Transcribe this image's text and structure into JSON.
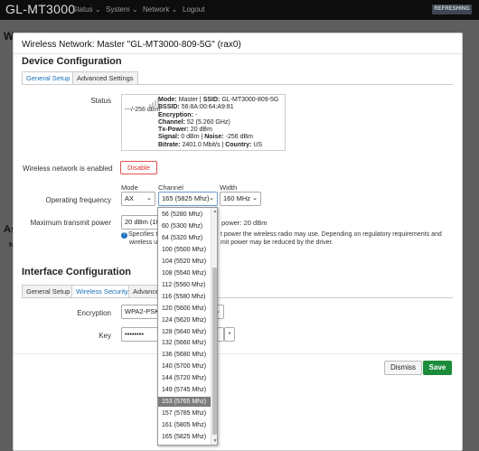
{
  "app": {
    "brand": "GL-MT3000",
    "nav": [
      "Status",
      "System",
      "Network",
      "Logout"
    ],
    "refresh_label": "REFRESHING"
  },
  "background": {
    "heading_w": "W",
    "heading_as": "As",
    "label_n": "N"
  },
  "modal": {
    "title": "Wireless Network: Master \"GL-MT3000-809-5G\" (rax0)",
    "device_config": {
      "heading": "Device Configuration",
      "tabs": [
        "General Setup",
        "Advanced Settings"
      ],
      "status_label": "Status",
      "status": {
        "signal_text": "---/-256 dBm",
        "mode_label": "Mode:",
        "mode_value": "Master",
        "ssid_label": "SSID:",
        "ssid_value": "GL-MT3000-809-5G",
        "bssid_label": "BSSID:",
        "bssid_value": "56:8A:00:64:A9:81",
        "encryption_label": "Encryption:",
        "encryption_value": "-",
        "channel_label": "Channel:",
        "channel_value": "52 (5.260 GHz)",
        "txpower_label": "Tx-Power:",
        "txpower_value": "20 dBm",
        "signal_label": "Signal:",
        "signal_value": "0 dBm",
        "noise_label": "Noise:",
        "noise_value": "-256 dBm",
        "bitrate_label": "Bitrate:",
        "bitrate_value": "2401.0 Mbit/s",
        "country_label": "Country:",
        "country_value": "US"
      },
      "enabled_label": "Wireless network is enabled",
      "disable_button": "Disable",
      "freq_label": "Operating frequency",
      "mode_col": "Mode",
      "channel_col": "Channel",
      "width_col": "Width",
      "mode_value": "AX",
      "channel_value": "165 (5825 Mhz)",
      "width_value": "160 MHz",
      "tx_label": "Maximum transmit power",
      "tx_value": "20 dBm (10",
      "tx_current": "power: 20 dBm",
      "hint_line1_start": "Specifies t",
      "hint_line1_end": "t power the wireless radio may use. Depending on regulatory requirements and",
      "hint_line2_start": "wireless u",
      "hint_line2_end": "mit power may be reduced by the driver."
    },
    "interface_config": {
      "heading": "Interface Configuration",
      "tabs": [
        "General Setup",
        "Wireless Security",
        "Advance"
      ],
      "encryption_label": "Encryption",
      "encryption_value": "WPA2-PSK",
      "key_label": "Key",
      "key_value": "••••••••",
      "reveal_symbol": "*"
    },
    "dismiss_button": "Dismiss",
    "save_button": "Save"
  },
  "channel_dropdown": {
    "options": [
      "56 (5280 Mhz)",
      "60 (5300 Mhz)",
      "64 (5320 Mhz)",
      "100 (5500 Mhz)",
      "104 (5520 Mhz)",
      "108 (5540 Mhz)",
      "112 (5560 Mhz)",
      "116 (5580 Mhz)",
      "120 (5600 Mhz)",
      "124 (5620 Mhz)",
      "128 (5640 Mhz)",
      "132 (5660 Mhz)",
      "136 (5680 Mhz)",
      "140 (5700 Mhz)",
      "144 (5720 Mhz)",
      "149 (5745 Mhz)",
      "153 (5765 Mhz)",
      "157 (5785 Mhz)",
      "161 (5805 Mhz)",
      "165 (5825 Mhz)"
    ],
    "highlighted": "153 (5765 Mhz)"
  }
}
